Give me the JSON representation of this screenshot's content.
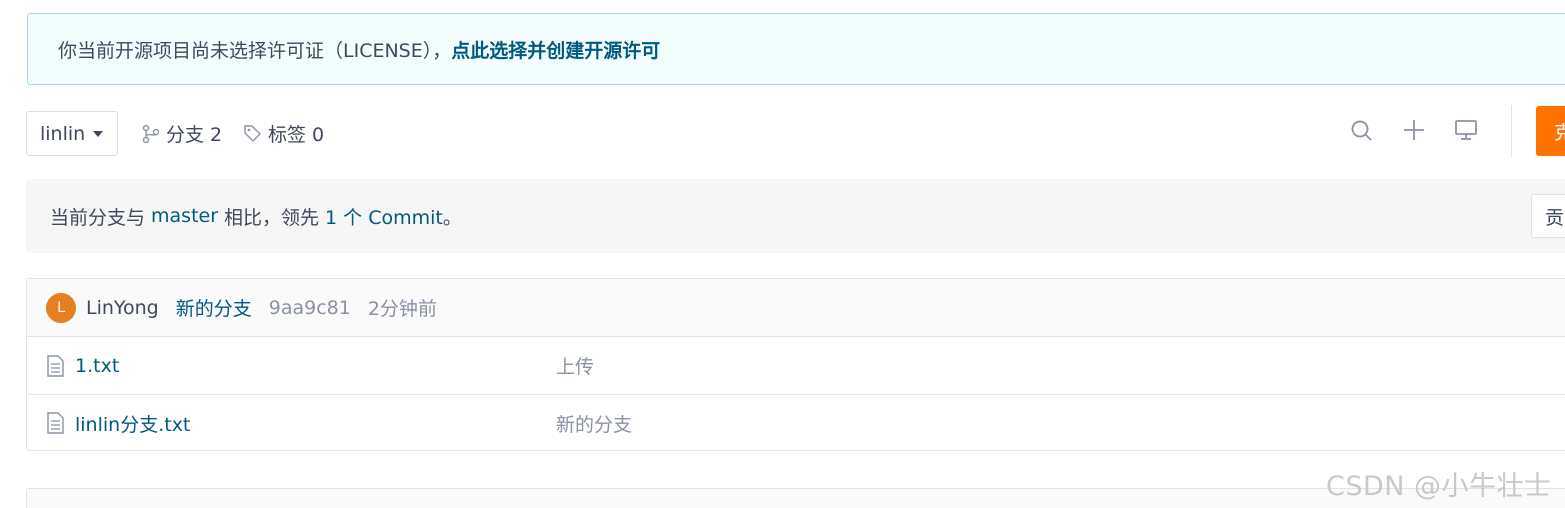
{
  "notice": {
    "text": "你当前开源项目尚未选择许可证（LICENSE），",
    "link": "点此选择并创建开源许可"
  },
  "toolbar": {
    "branch": "linlin",
    "branches_label": "分支 2",
    "tags_label": "标签 0",
    "clone_label": "克"
  },
  "compare": {
    "prefix": "当前分支与 ",
    "base": "master",
    "middle": " 相比，领先 ",
    "ahead": "1 个 Commit",
    "suffix": "。",
    "contrib_label": "贡"
  },
  "commit": {
    "avatar_letter": "L",
    "author": "LinYong",
    "message": "新的分支",
    "sha": "9aa9c81",
    "time": "2分钟前"
  },
  "files": [
    {
      "name": "1.txt",
      "message": "上传"
    },
    {
      "name": "linlin分支.txt",
      "message": "新的分支"
    }
  ],
  "watermark": "CSDN @小牛壮士",
  "colors": {
    "accent": "#fe7300",
    "link": "#005980",
    "notice_bg": "#f4fdfe"
  },
  "icons": [
    "branch-icon",
    "tag-icon",
    "search-icon",
    "plus-icon",
    "monitor-icon",
    "file-icon"
  ]
}
